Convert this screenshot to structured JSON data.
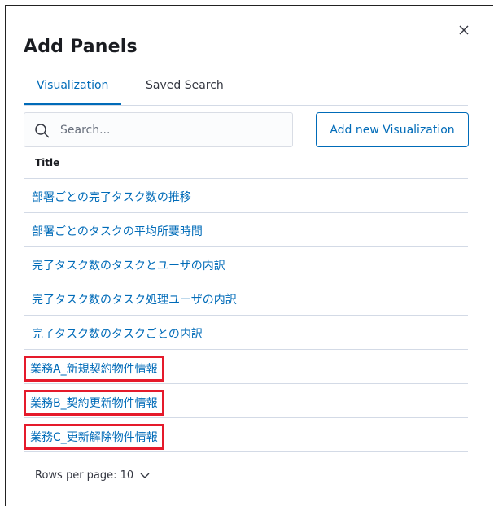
{
  "modal": {
    "title": "Add Panels"
  },
  "tabs": [
    {
      "label": "Visualization",
      "active": true
    },
    {
      "label": "Saved Search",
      "active": false
    }
  ],
  "search": {
    "placeholder": "Search...",
    "value": ""
  },
  "toolbar": {
    "add_label": "Add new Visualization"
  },
  "table": {
    "column_title": "Title",
    "rows": [
      {
        "title": "部署ごとの完了タスク数の推移",
        "highlighted": false
      },
      {
        "title": "部署ごとのタスクの平均所要時間",
        "highlighted": false
      },
      {
        "title": "完了タスク数のタスクとユーザの内訳",
        "highlighted": false
      },
      {
        "title": "完了タスク数のタスク処理ユーザの内訳",
        "highlighted": false
      },
      {
        "title": "完了タスク数のタスクごとの内訳",
        "highlighted": false
      },
      {
        "title": "業務A_新規契約物件情報",
        "highlighted": true
      },
      {
        "title": "業務B_契約更新物件情報",
        "highlighted": true
      },
      {
        "title": "業務C_更新解除物件情報",
        "highlighted": true
      }
    ]
  },
  "pagination": {
    "rows_per_page_label": "Rows per page: 10"
  },
  "colors": {
    "accent": "#006bb8",
    "highlight_border": "#e51a2b",
    "divider": "#d3dae6"
  },
  "icons": {
    "close": "close-icon",
    "search": "search-icon",
    "chevron": "chevron-down-icon"
  }
}
